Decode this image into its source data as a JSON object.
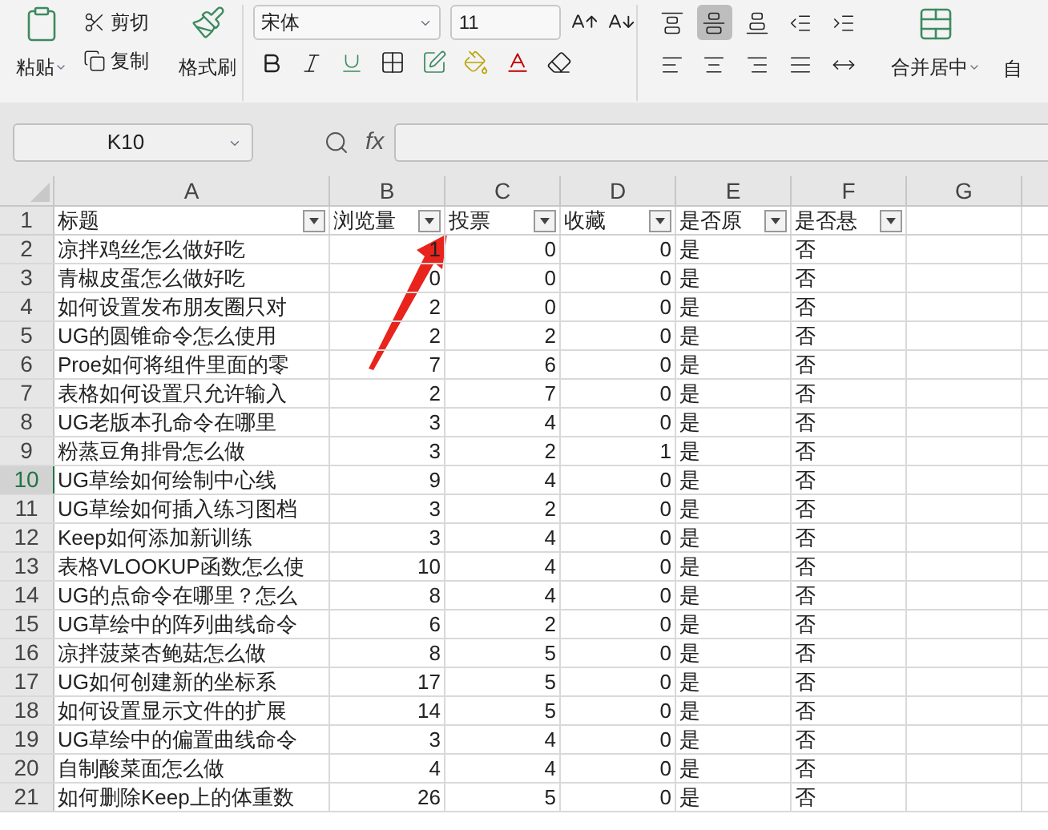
{
  "ribbon": {
    "paste": "粘贴",
    "cut": "剪切",
    "copy": "复制",
    "format_painter": "格式刷",
    "font": "宋体",
    "font_size": "11",
    "align_buttons": [
      {
        "selected": false
      },
      {
        "selected": true
      },
      {
        "selected": false
      },
      {
        "selected": false
      },
      {
        "selected": false
      },
      {
        "selected": false
      },
      {
        "selected": false
      },
      {
        "selected": false
      },
      {
        "selected": false
      },
      {
        "selected": false
      }
    ],
    "merge": "合并居中",
    "wrap": "自"
  },
  "formula_bar": {
    "name_box": "K10",
    "fx": "fx"
  },
  "columns": [
    "A",
    "B",
    "C",
    "D",
    "E",
    "F",
    "G"
  ],
  "rows": [
    {
      "number": "1",
      "selected": false,
      "header": true,
      "cells": [
        "标题",
        "浏览量",
        "投票",
        "收藏",
        "是否原",
        "是否悬"
      ]
    },
    {
      "number": "2",
      "selected": false,
      "cells": [
        "凉拌鸡丝怎么做好吃",
        "1",
        "0",
        "0",
        "是",
        "否"
      ]
    },
    {
      "number": "3",
      "selected": false,
      "cells": [
        "青椒皮蛋怎么做好吃",
        "0",
        "0",
        "0",
        "是",
        "否"
      ]
    },
    {
      "number": "4",
      "selected": false,
      "cells": [
        "如何设置发布朋友圈只对",
        "2",
        "0",
        "0",
        "是",
        "否"
      ]
    },
    {
      "number": "5",
      "selected": false,
      "cells": [
        "UG的圆锥命令怎么使用",
        "2",
        "2",
        "0",
        "是",
        "否"
      ]
    },
    {
      "number": "6",
      "selected": false,
      "cells": [
        "Proe如何将组件里面的零",
        "7",
        "6",
        "0",
        "是",
        "否"
      ]
    },
    {
      "number": "7",
      "selected": false,
      "cells": [
        "表格如何设置只允许输入",
        "2",
        "7",
        "0",
        "是",
        "否"
      ]
    },
    {
      "number": "8",
      "selected": false,
      "cells": [
        "UG老版本孔命令在哪里",
        "3",
        "4",
        "0",
        "是",
        "否"
      ]
    },
    {
      "number": "9",
      "selected": false,
      "cells": [
        "粉蒸豆角排骨怎么做",
        "3",
        "2",
        "1",
        "是",
        "否"
      ]
    },
    {
      "number": "10",
      "selected": true,
      "cells": [
        "UG草绘如何绘制中心线",
        "9",
        "4",
        "0",
        "是",
        "否"
      ]
    },
    {
      "number": "11",
      "selected": false,
      "cells": [
        "UG草绘如何插入练习图档",
        "3",
        "2",
        "0",
        "是",
        "否"
      ]
    },
    {
      "number": "12",
      "selected": false,
      "cells": [
        "Keep如何添加新训练",
        "3",
        "4",
        "0",
        "是",
        "否"
      ]
    },
    {
      "number": "13",
      "selected": false,
      "cells": [
        "表格VLOOKUP函数怎么使",
        "10",
        "4",
        "0",
        "是",
        "否"
      ]
    },
    {
      "number": "14",
      "selected": false,
      "cells": [
        "UG的点命令在哪里？怎么",
        "8",
        "4",
        "0",
        "是",
        "否"
      ]
    },
    {
      "number": "15",
      "selected": false,
      "cells": [
        "UG草绘中的阵列曲线命令",
        "6",
        "2",
        "0",
        "是",
        "否"
      ]
    },
    {
      "number": "16",
      "selected": false,
      "cells": [
        "凉拌菠菜杏鲍菇怎么做",
        "8",
        "5",
        "0",
        "是",
        "否"
      ]
    },
    {
      "number": "17",
      "selected": false,
      "cells": [
        "UG如何创建新的坐标系",
        "17",
        "5",
        "0",
        "是",
        "否"
      ]
    },
    {
      "number": "18",
      "selected": false,
      "cells": [
        "如何设置显示文件的扩展",
        "14",
        "5",
        "0",
        "是",
        "否"
      ]
    },
    {
      "number": "19",
      "selected": false,
      "cells": [
        "UG草绘中的偏置曲线命令",
        "3",
        "4",
        "0",
        "是",
        "否"
      ]
    },
    {
      "number": "20",
      "selected": false,
      "cells": [
        "自制酸菜面怎么做",
        "4",
        "4",
        "0",
        "是",
        "否"
      ]
    },
    {
      "number": "21",
      "selected": false,
      "cells": [
        "如何删除Keep上的体重数",
        "26",
        "5",
        "0",
        "是",
        "否"
      ]
    }
  ]
}
